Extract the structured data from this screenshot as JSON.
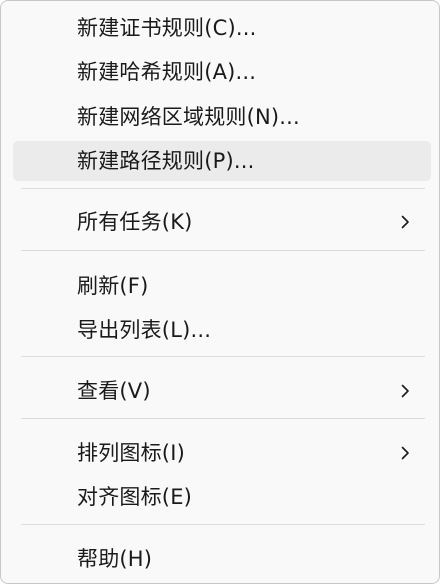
{
  "menu": {
    "items": [
      {
        "label": "新建证书规则(C)...",
        "submenu": false,
        "hovered": false
      },
      {
        "label": "新建哈希规则(A)...",
        "submenu": false,
        "hovered": false
      },
      {
        "label": "新建网络区域规则(N)...",
        "submenu": false,
        "hovered": false
      },
      {
        "label": "新建路径规则(P)...",
        "submenu": false,
        "hovered": true
      },
      {
        "label": "所有任务(K)",
        "submenu": true,
        "hovered": false
      },
      {
        "label": "刷新(F)",
        "submenu": false,
        "hovered": false
      },
      {
        "label": "导出列表(L)...",
        "submenu": false,
        "hovered": false
      },
      {
        "label": "查看(V)",
        "submenu": true,
        "hovered": false
      },
      {
        "label": "排列图标(I)",
        "submenu": true,
        "hovered": false
      },
      {
        "label": "对齐图标(E)",
        "submenu": false,
        "hovered": false
      },
      {
        "label": "帮助(H)",
        "submenu": false,
        "hovered": false
      }
    ]
  },
  "icons": {
    "submenu_arrow": "chevron-right-icon"
  },
  "colors": {
    "menu_background": "#f9f9f9",
    "hover_background": "#ebebeb",
    "separator": "#dcdcdc",
    "text": "#1a1a1a"
  }
}
